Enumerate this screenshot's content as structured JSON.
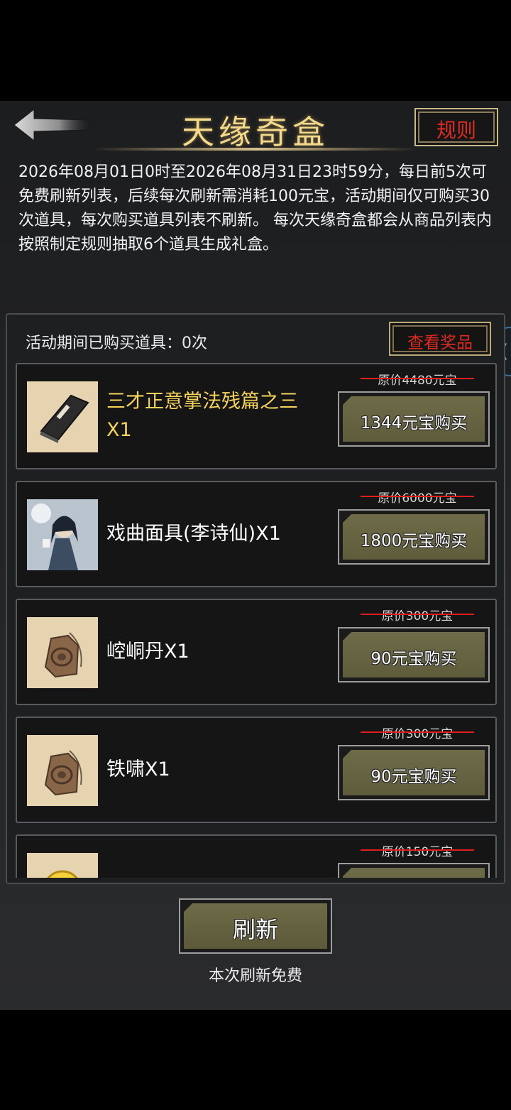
{
  "header": {
    "title": "天缘奇盒",
    "rules_label": "规则"
  },
  "description": "2026年08月01日0时至2026年08月31日23时59分，每日前5次可免费刷新列表，后续每次刷新需消耗100元宝，活动期间仅可购买30次道具，每次购买道具列表不刷新。 每次天缘奇盒都会从商品列表内按照制定规则抽取6个道具生成礼盒。",
  "shop": {
    "purchased_label": "活动期间已购买道具：0次",
    "view_prizes_label": "查看奖品",
    "items": [
      {
        "name": "三才正意掌法残篇之三X1",
        "original_price": "原价4480元宝",
        "buy_label": "1344元宝购买",
        "icon": "book-icon",
        "name_color": "#f5d45a"
      },
      {
        "name": "戏曲面具(李诗仙)X1",
        "original_price": "原价6000元宝",
        "buy_label": "1800元宝购买",
        "icon": "swordsman-portrait-icon",
        "name_color": "#ffffff"
      },
      {
        "name": "崆峒丹X1",
        "original_price": "原价300元宝",
        "buy_label": "90元宝购买",
        "icon": "token-pendant-icon",
        "name_color": "#ffffff"
      },
      {
        "name": "铁啸X1",
        "original_price": "原价300元宝",
        "buy_label": "90元宝购买",
        "icon": "token-pendant-icon",
        "name_color": "#ffffff"
      },
      {
        "name": "",
        "original_price": "原价150元宝",
        "buy_label": "",
        "icon": "gold-pearl-icon",
        "name_color": "#ffffff"
      }
    ]
  },
  "footer": {
    "refresh_label": "刷新",
    "refresh_note": "本次刷新免费"
  },
  "side_tab_label": "("
}
